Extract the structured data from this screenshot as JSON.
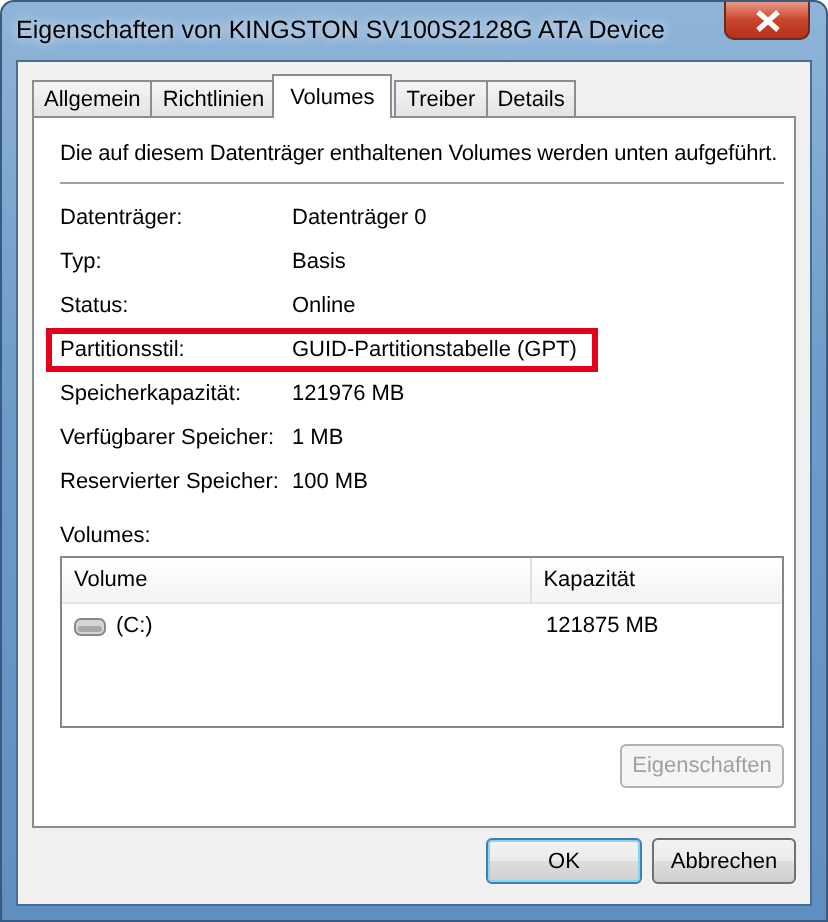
{
  "window": {
    "title": "Eigenschaften von KINGSTON SV100S2128G ATA Device"
  },
  "tabs": [
    {
      "label": "Allgemein",
      "selected": false
    },
    {
      "label": "Richtlinien",
      "selected": false
    },
    {
      "label": "Volumes",
      "selected": true
    },
    {
      "label": "Treiber",
      "selected": false
    },
    {
      "label": "Details",
      "selected": false
    }
  ],
  "description": "Die auf diesem Datenträger enthaltenen Volumes werden unten aufgeführt.",
  "properties": [
    {
      "label": "Datenträger:",
      "value": "Datenträger 0",
      "highlighted": false
    },
    {
      "label": "Typ:",
      "value": "Basis",
      "highlighted": false
    },
    {
      "label": "Status:",
      "value": "Online",
      "highlighted": false
    },
    {
      "label": "Partitionsstil:",
      "value": "GUID-Partitionstabelle (GPT)",
      "highlighted": true
    },
    {
      "label": "Speicherkapazität:",
      "value": "121976 MB",
      "highlighted": false
    },
    {
      "label": "Verfügbarer Speicher:",
      "value": "1 MB",
      "highlighted": false
    },
    {
      "label": "Reservierter Speicher:",
      "value": "100 MB",
      "highlighted": false
    }
  ],
  "volumes": {
    "label": "Volumes:",
    "columns": [
      "Volume",
      "Kapazität"
    ],
    "rows": [
      {
        "volume": "(C:)",
        "capacity": "121875 MB"
      }
    ],
    "properties_button": {
      "label": "Eigenschaften",
      "disabled": true
    }
  },
  "buttons": [
    {
      "label": "OK",
      "kind": "default"
    },
    {
      "label": "Abbrechen",
      "kind": "normal"
    }
  ]
}
